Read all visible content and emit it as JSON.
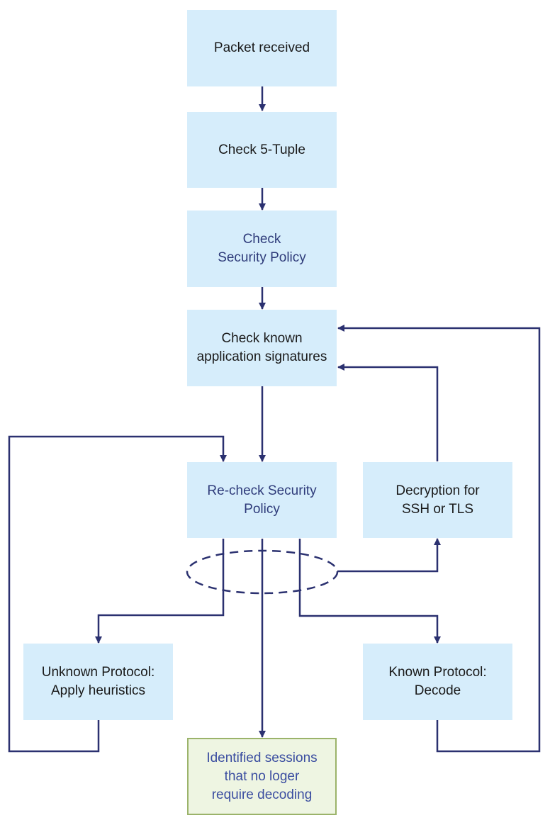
{
  "diagram": {
    "colors": {
      "box_fill": "#d6edfb",
      "terminal_fill": "#eef5e2",
      "terminal_border": "#9bb36a",
      "connector": "#2b3170",
      "policy_text": "#2e3b7a",
      "terminal_text": "#3a4da0"
    },
    "nodes": [
      {
        "id": "packet-received",
        "label": "Packet received"
      },
      {
        "id": "check-5-tuple",
        "label": "Check 5-Tuple"
      },
      {
        "id": "check-security-policy",
        "label": "Check\nSecurity Policy"
      },
      {
        "id": "check-app-signatures",
        "label": "Check known\napplication signatures"
      },
      {
        "id": "recheck-security-policy",
        "label": "Re-check Security\nPolicy"
      },
      {
        "id": "decryption",
        "label": "Decryption for\nSSH or TLS"
      },
      {
        "id": "unknown-protocol",
        "label": "Unknown Protocol:\nApply heuristics"
      },
      {
        "id": "known-protocol",
        "label": "Known Protocol:\nDecode"
      },
      {
        "id": "identified-sessions",
        "label": "Identified sessions\nthat no loger\nrequire decoding"
      }
    ],
    "edges": [
      {
        "from": "packet-received",
        "to": "check-5-tuple"
      },
      {
        "from": "check-5-tuple",
        "to": "check-security-policy"
      },
      {
        "from": "check-security-policy",
        "to": "check-app-signatures"
      },
      {
        "from": "check-app-signatures",
        "to": "recheck-security-policy"
      },
      {
        "from": "recheck-security-policy",
        "to": "unknown-protocol"
      },
      {
        "from": "recheck-security-policy",
        "to": "identified-sessions"
      },
      {
        "from": "recheck-security-policy",
        "to": "known-protocol"
      },
      {
        "from": "recheck-security-policy",
        "to": "decryption",
        "style": "grouped-dashed-ellipse"
      },
      {
        "from": "decryption",
        "to": "check-app-signatures"
      },
      {
        "from": "known-protocol",
        "to": "check-app-signatures"
      },
      {
        "from": "unknown-protocol",
        "to": "recheck-security-policy"
      }
    ]
  }
}
